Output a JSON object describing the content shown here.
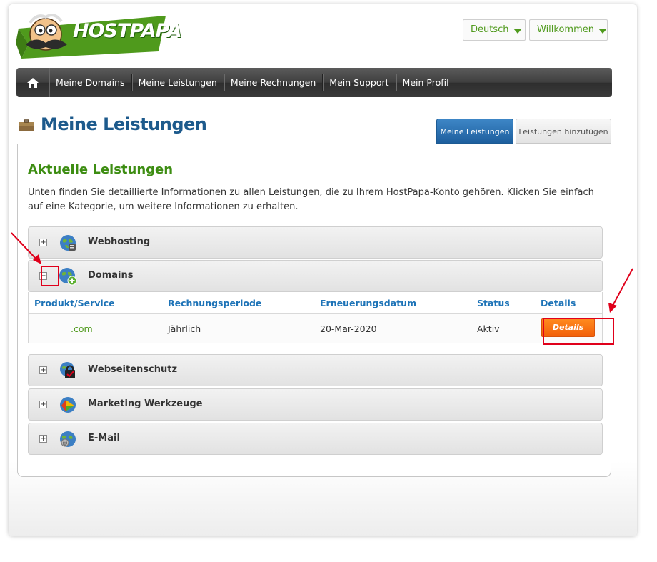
{
  "brand": {
    "logo_text": "HOSTPAPA"
  },
  "header": {
    "language_label": "Deutsch",
    "welcome_label": "Willkommen"
  },
  "nav": {
    "items": [
      "Meine Domains",
      "Meine Leistungen",
      "Meine Rechnungen",
      "Mein Support",
      "Mein Profil"
    ]
  },
  "page": {
    "title": "Meine Leistungen",
    "tabs": [
      "Meine Leistungen",
      "Leistungen hinzufügen"
    ],
    "active_tab": "Meine Leistungen"
  },
  "content": {
    "section_title": "Aktuelle Leistungen",
    "intro": "Unten finden Sie detaillierte Informationen zu allen Leistungen, die zu Ihrem HostPapa-Konto gehören. Klicken Sie einfach auf eine Kategorie, um weitere Informationen zu erhalten."
  },
  "categories": [
    {
      "label": "Webhosting",
      "icon": "webhosting-globe-icon",
      "expanded": false,
      "toggle": "+"
    },
    {
      "label": "Domains",
      "icon": "domains-globe-icon",
      "expanded": true,
      "toggle": "−"
    },
    {
      "label": "Webseitenschutz",
      "icon": "security-lock-icon",
      "expanded": false,
      "toggle": "+"
    },
    {
      "label": "Marketing Werkzeuge",
      "icon": "marketing-globe-icon",
      "expanded": false,
      "toggle": "+"
    },
    {
      "label": "E-Mail",
      "icon": "email-globe-icon",
      "expanded": false,
      "toggle": "+"
    }
  ],
  "domains_table": {
    "headers": [
      "Produkt/Service",
      "Rechnungsperiode",
      "Erneuerungsdatum",
      "Status",
      "Details"
    ],
    "rows": [
      {
        "product": ".com",
        "period": "Jährlich",
        "renewal": "20-Mar-2020",
        "status": "Aktiv",
        "button": "Details"
      }
    ]
  },
  "colors": {
    "brand_green": "#4f9a1c",
    "title_blue": "#1d5a8c",
    "link_blue": "#1d73b7",
    "button_orange": "#f2600a",
    "annotation_red": "#e0001b"
  }
}
